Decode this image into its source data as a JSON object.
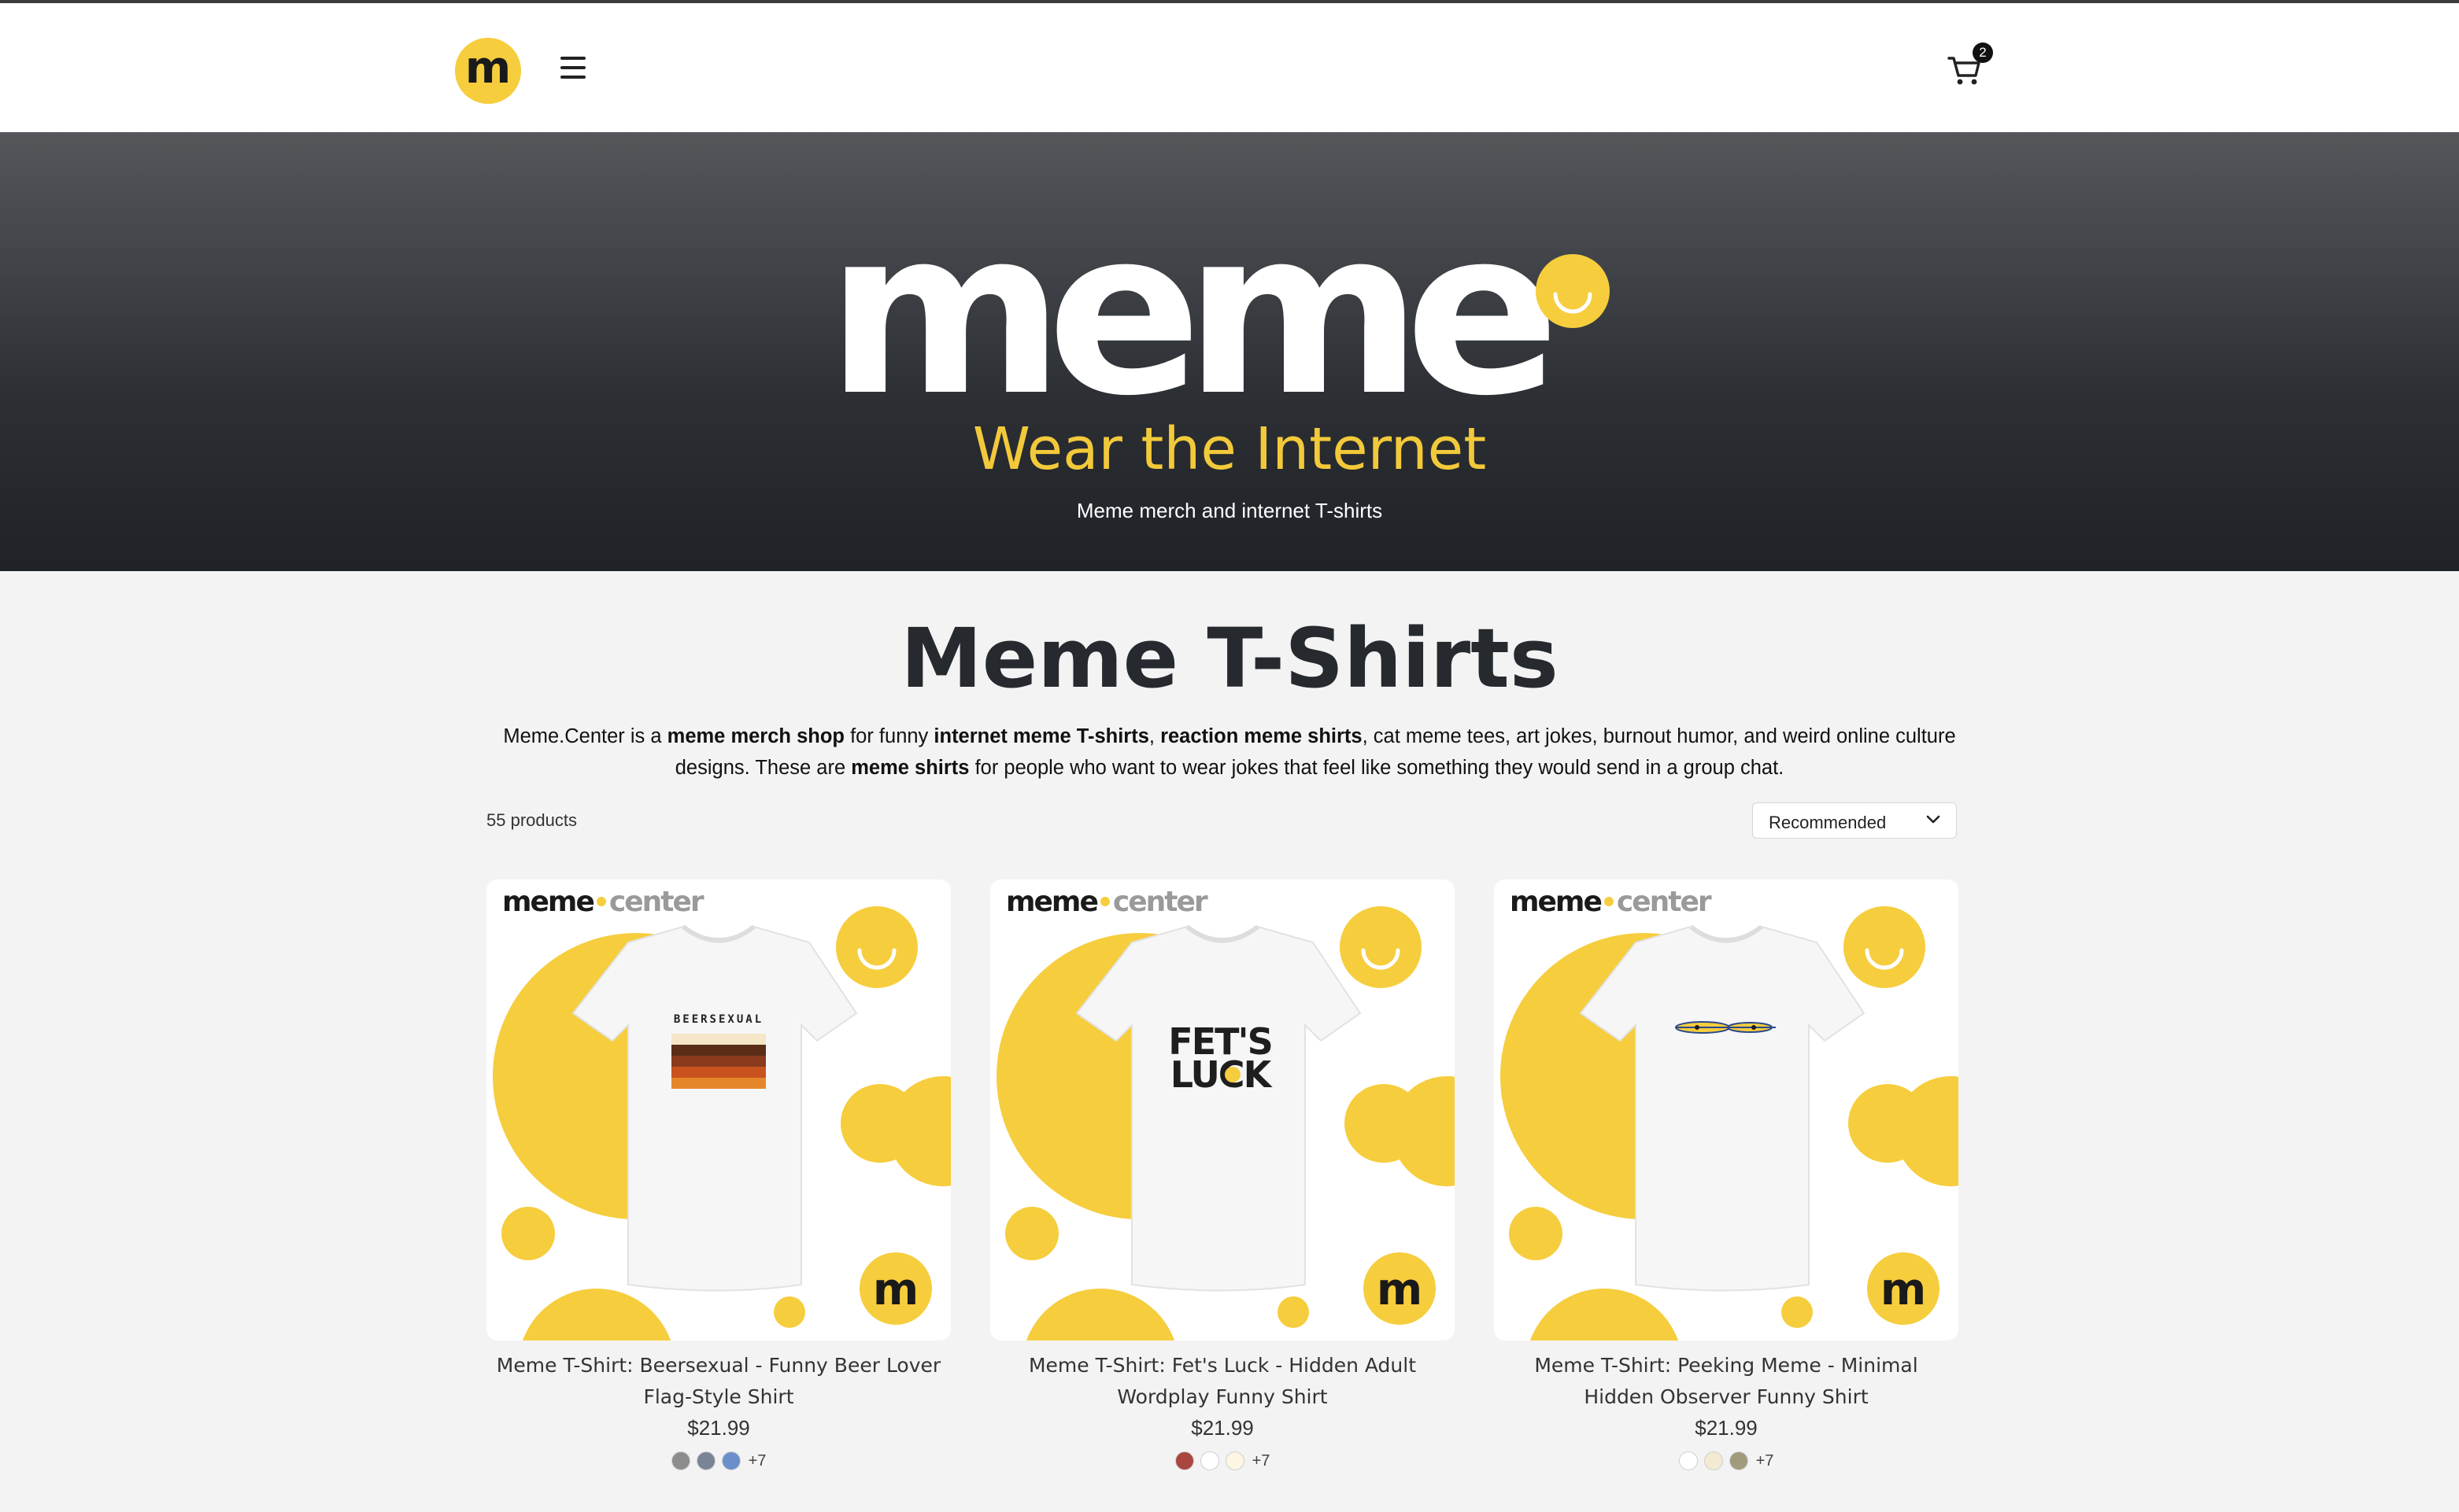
{
  "header": {
    "logo_letter": "m",
    "cart_count": "2",
    "icons": {
      "menu": "hamburger-menu-icon",
      "cart": "shopping-cart-icon"
    }
  },
  "hero": {
    "wordmark": "meme",
    "tagline": "Wear the Internet",
    "subtitle": "Meme merch and internet T-shirts"
  },
  "main": {
    "title": "Meme T-Shirts",
    "intro": {
      "p1": "Meme.Center is a ",
      "b1": "meme merch shop",
      "p2": " for funny ",
      "b2": "internet meme T-shirts",
      "p3": ", ",
      "b3": "reaction meme shirts",
      "p4": ", cat meme tees, art jokes, burnout humor, and weird online culture designs. These are ",
      "b4": "meme shirts",
      "p5": " for people who want to wear jokes that feel like something they would send in a group chat."
    },
    "product_count": "55 products",
    "sort": {
      "selected": "Recommended"
    }
  },
  "brand": {
    "name": "meme",
    "suffix": "center",
    "badge_letter": "m"
  },
  "products": [
    {
      "title": "Meme T-Shirt: Beersexual - Funny Beer Lover Flag-Style Shirt",
      "price": "$21.99",
      "print_text": "BEERSEXUAL",
      "swatches": [
        "#8c8c8c",
        "#7b8494",
        "#6b8fca"
      ],
      "more": "+7"
    },
    {
      "title": "Meme T-Shirt: Fet's Luck - Hidden Adult Wordplay Funny Shirt",
      "price": "$21.99",
      "print_text_1": "FET'S",
      "print_text_2": "LUCK",
      "swatches": [
        "#a8463f",
        "#ffffff",
        "#fdf6e3"
      ],
      "more": "+7"
    },
    {
      "title": "Meme T-Shirt: Peeking Meme - Minimal Hidden Observer Funny Shirt",
      "price": "$21.99",
      "swatches": [
        "#ffffff",
        "#f3ead2",
        "#a09b7a"
      ],
      "more": "+7"
    }
  ],
  "colors": {
    "accent_yellow": "#f6cd3d",
    "tagline_yellow": "#f2c93a",
    "hero_dark": "#2c2f34"
  }
}
